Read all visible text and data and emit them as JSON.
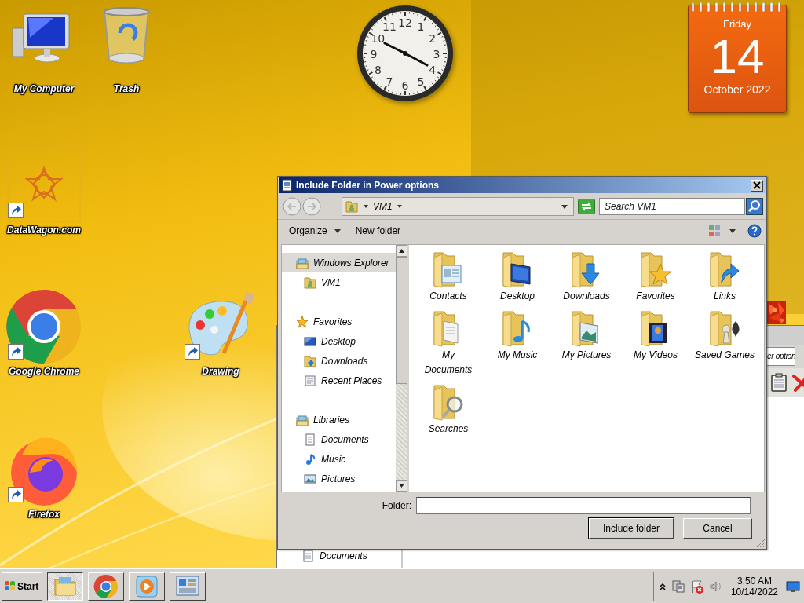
{
  "desktop": {
    "icons": [
      {
        "label": "My Computer",
        "kind": "computer",
        "shortcut": false
      },
      {
        "label": "Trash",
        "kind": "trash",
        "shortcut": false
      },
      {
        "label": "DataWagon.com",
        "kind": "star",
        "shortcut": true
      },
      {
        "label": "Google Chrome",
        "kind": "chrome",
        "shortcut": true
      },
      {
        "label": "Drawing",
        "kind": "palette",
        "shortcut": true
      },
      {
        "label": "Firefox",
        "kind": "firefox",
        "shortcut": true
      }
    ]
  },
  "clock": {
    "numerals": [
      "12",
      "11",
      "1",
      "10",
      "2",
      "9",
      "3",
      "8",
      "4",
      "7",
      "5",
      "6"
    ]
  },
  "calendar": {
    "weekday": "Friday",
    "day": "14",
    "month_year": "October 2022"
  },
  "background_window": {
    "address": "er option",
    "sidebar_item": "Documents"
  },
  "dialog": {
    "title": "Include Folder in Power options",
    "address": {
      "crumb": "VM1"
    },
    "search": {
      "placeholder": "Search VM1"
    },
    "toolbar": {
      "organize": "Organize",
      "new_folder": "New folder"
    },
    "navigation": [
      {
        "label": "Windows Explorer",
        "kind": "libraries",
        "selected": true,
        "children": [
          {
            "label": "VM1",
            "kind": "user",
            "selected": false
          }
        ]
      },
      {
        "label": "Favorites",
        "kind": "star",
        "selected": false,
        "children": [
          {
            "label": "Desktop",
            "kind": "desktop",
            "selected": false
          },
          {
            "label": "Downloads",
            "kind": "downloads",
            "selected": false
          },
          {
            "label": "Recent Places",
            "kind": "recent",
            "selected": false
          }
        ]
      },
      {
        "label": "Libraries",
        "kind": "libraries",
        "selected": false,
        "children": [
          {
            "label": "Documents",
            "kind": "document",
            "selected": false
          },
          {
            "label": "Music",
            "kind": "music",
            "selected": false
          },
          {
            "label": "Pictures",
            "kind": "pictures",
            "selected": false
          }
        ]
      }
    ],
    "folders": [
      {
        "label": "Contacts",
        "kind": "contacts"
      },
      {
        "label": "Desktop",
        "kind": "desktop"
      },
      {
        "label": "Downloads",
        "kind": "downloads"
      },
      {
        "label": "Favorites",
        "kind": "favorites"
      },
      {
        "label": "Links",
        "kind": "links"
      },
      {
        "label": "My Documents",
        "kind": "documents"
      },
      {
        "label": "My Music",
        "kind": "music"
      },
      {
        "label": "My Pictures",
        "kind": "pictures"
      },
      {
        "label": "My Videos",
        "kind": "videos"
      },
      {
        "label": "Saved Games",
        "kind": "games"
      },
      {
        "label": "Searches",
        "kind": "searches"
      }
    ],
    "folder_field": {
      "label": "Folder:"
    },
    "buttons": [
      {
        "label": "Include folder",
        "default": true
      },
      {
        "label": "Cancel",
        "default": false
      }
    ]
  },
  "taskbar": {
    "start": "Start",
    "apps": [
      {
        "kind": "explorer",
        "selected": true
      },
      {
        "kind": "chrome",
        "selected": false
      },
      {
        "kind": "media",
        "selected": false
      },
      {
        "kind": "control",
        "selected": false
      }
    ],
    "tray": {
      "time": "3:50 AM",
      "date": "10/14/2022"
    }
  }
}
